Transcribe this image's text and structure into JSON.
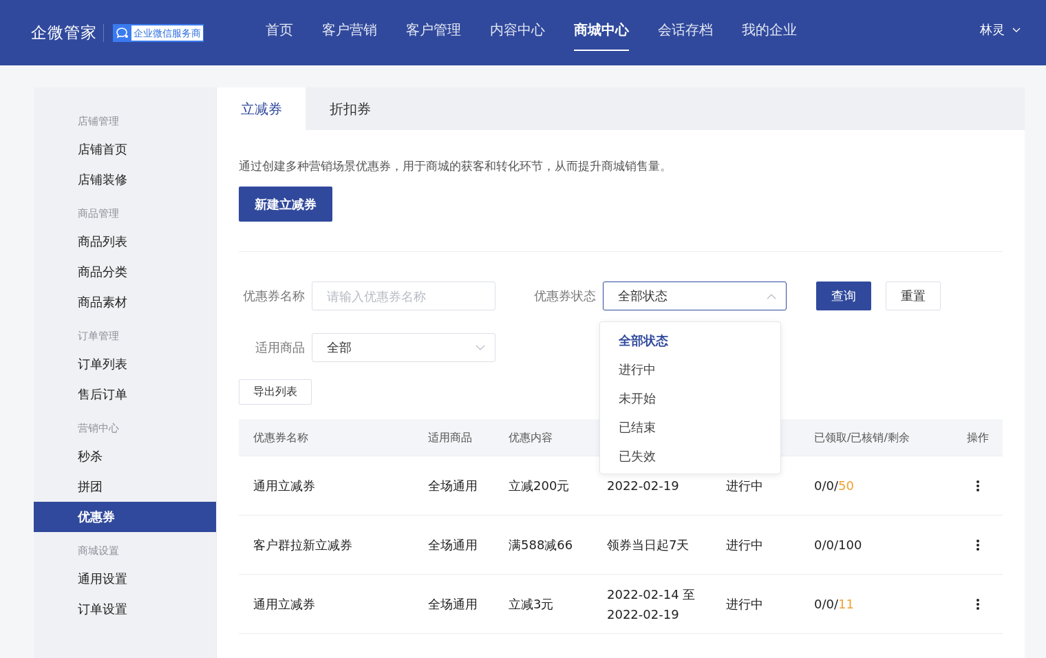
{
  "header": {
    "brand": "企微管家",
    "badge": "企业微信服务商",
    "nav": [
      {
        "label": "首页",
        "selected": false
      },
      {
        "label": "客户营销",
        "selected": false
      },
      {
        "label": "客户管理",
        "selected": false
      },
      {
        "label": "内容中心",
        "selected": false
      },
      {
        "label": "商城中心",
        "selected": true
      },
      {
        "label": "会话存档",
        "selected": false
      },
      {
        "label": "我的企业",
        "selected": false
      }
    ],
    "user": "林灵"
  },
  "sidebar": {
    "groups": [
      {
        "title": "店铺管理",
        "items": [
          {
            "label": "店铺首页",
            "selected": false
          },
          {
            "label": "店铺装修",
            "selected": false
          }
        ]
      },
      {
        "title": "商品管理",
        "items": [
          {
            "label": "商品列表",
            "selected": false
          },
          {
            "label": "商品分类",
            "selected": false
          },
          {
            "label": "商品素材",
            "selected": false
          }
        ]
      },
      {
        "title": "订单管理",
        "items": [
          {
            "label": "订单列表",
            "selected": false
          },
          {
            "label": "售后订单",
            "selected": false
          }
        ]
      },
      {
        "title": "营销中心",
        "items": [
          {
            "label": "秒杀",
            "selected": false
          },
          {
            "label": "拼团",
            "selected": false
          },
          {
            "label": "优惠券",
            "selected": true
          }
        ]
      },
      {
        "title": "商城设置",
        "items": [
          {
            "label": "通用设置",
            "selected": false
          },
          {
            "label": "订单设置",
            "selected": false
          }
        ]
      }
    ]
  },
  "tabs": [
    {
      "label": "立减券",
      "selected": true
    },
    {
      "label": "折扣券",
      "selected": false
    }
  ],
  "description": "通过创建多种营销场景优惠券，用于商城的获客和转化环节，从而提升商城销售量。",
  "create_button": "新建立减券",
  "filters": {
    "name_label": "优惠券名称",
    "name_placeholder": "请输入优惠券名称",
    "status_label": "优惠券状态",
    "status_value": "全部状态",
    "status_expanded": true,
    "goods_label": "适用商品",
    "goods_value": "全部",
    "query_button": "查询",
    "reset_button": "重置"
  },
  "status_options": [
    {
      "label": "全部状态",
      "selected": true
    },
    {
      "label": "进行中",
      "selected": false
    },
    {
      "label": "未开始",
      "selected": false
    },
    {
      "label": "已结束",
      "selected": false
    },
    {
      "label": "已失效",
      "selected": false
    }
  ],
  "export_button": "导出列表",
  "table": {
    "columns": [
      "优惠券名称",
      "适用商品",
      "优惠内容",
      "已领取/已核销/剩余",
      "操作"
    ],
    "rows": [
      {
        "name": "通用立减券",
        "goods": "全场通用",
        "content": "立减200元",
        "validity": [
          "2022-02-19"
        ],
        "status": "进行中",
        "counts": "0/0/",
        "remaining": "50",
        "low": true
      },
      {
        "name": "客户群拉新立减券",
        "goods": "全场通用",
        "content": "满588减66",
        "validity": [
          "领券当日起7天"
        ],
        "status": "进行中",
        "counts": "0/0/",
        "remaining": "100",
        "low": false
      },
      {
        "name": "通用立减券",
        "goods": "全场通用",
        "content": "立减3元",
        "validity": [
          "2022-02-14 至",
          "2022-02-19"
        ],
        "status": "进行中",
        "counts": "0/0/",
        "remaining": "11",
        "low": true
      }
    ]
  }
}
